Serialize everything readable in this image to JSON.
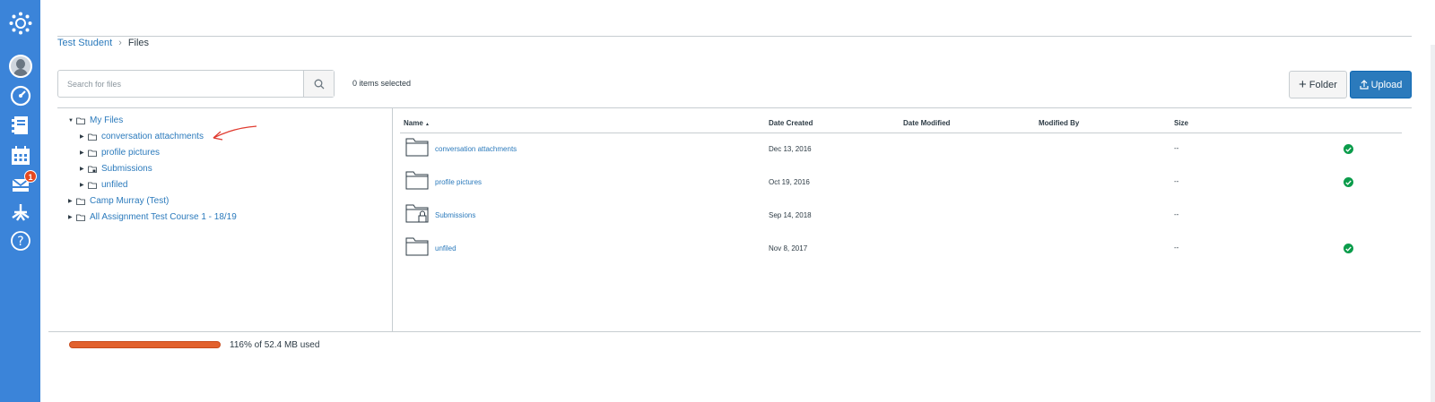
{
  "breadcrumb": {
    "parent": "Test Student",
    "current": "Files"
  },
  "search": {
    "placeholder": "Search for files"
  },
  "selection": {
    "status": "0 items selected"
  },
  "toolbar": {
    "folder_label": "Folder",
    "upload_label": "Upload"
  },
  "nav": {
    "inbox_badge": "1"
  },
  "tree": {
    "root": "My Files",
    "children": [
      "conversation attachments",
      "profile pictures",
      "Submissions",
      "unfiled"
    ],
    "others": [
      "Camp Murray (Test)",
      "All Assignment Test Course 1 - 18/19"
    ]
  },
  "table": {
    "columns": {
      "name": "Name",
      "created": "Date Created",
      "modified": "Date Modified",
      "modified_by": "Modified By",
      "size": "Size"
    },
    "sort_indicator": "▲",
    "rows": [
      {
        "name": "conversation attachments",
        "created": "Dec 13, 2016",
        "size": "--",
        "published": true,
        "locked": false
      },
      {
        "name": "profile pictures",
        "created": "Oct 19, 2016",
        "size": "--",
        "published": true,
        "locked": false
      },
      {
        "name": "Submissions",
        "created": "Sep 14, 2018",
        "size": "--",
        "published": false,
        "locked": true
      },
      {
        "name": "unfiled",
        "created": "Nov 8, 2017",
        "size": "--",
        "published": true,
        "locked": false
      }
    ]
  },
  "quota": {
    "text": "116% of 52.4 MB used",
    "percent": 116
  },
  "colors": {
    "nav_bg": "#3b84d9",
    "link": "#2b7abc",
    "primary_button": "#2b7abc",
    "quota_bar": "#e2612d",
    "published": "#0b9c4b",
    "badge": "#e5491f"
  },
  "icons": [
    "canvas-logo-icon",
    "avatar",
    "dashboard-icon",
    "courses-icon",
    "calendar-icon",
    "inbox-icon",
    "commons-icon",
    "help-icon",
    "search-icon",
    "plus-icon",
    "upload-icon",
    "folder-icon",
    "locked-folder-icon",
    "checkmark-icon"
  ]
}
